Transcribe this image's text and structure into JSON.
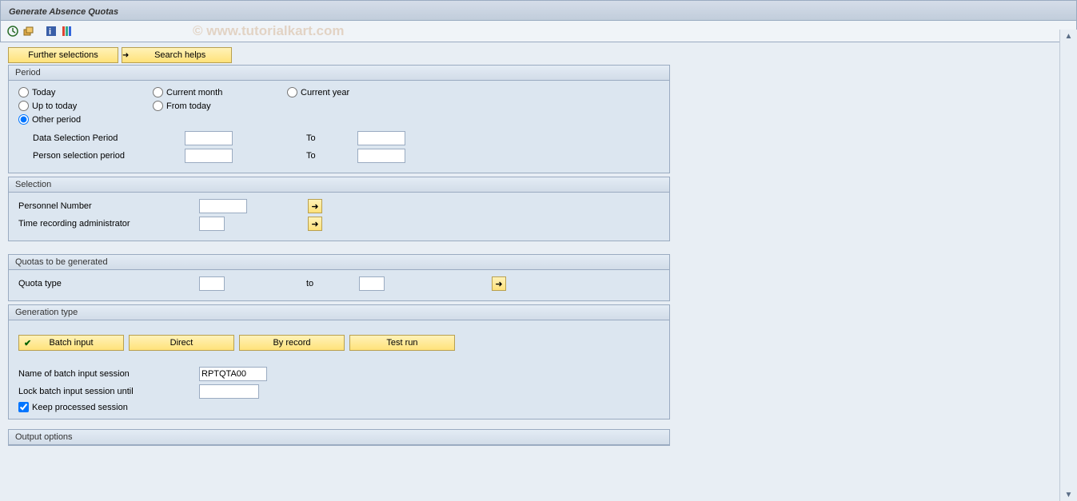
{
  "title": "Generate Absence Quotas",
  "watermark": "© www.tutorialkart.com",
  "topButtons": {
    "furtherSelections": "Further selections",
    "searchHelps": "Search helps"
  },
  "period": {
    "title": "Period",
    "today": "Today",
    "currentMonth": "Current month",
    "currentYear": "Current year",
    "upToToday": "Up to today",
    "fromToday": "From today",
    "otherPeriod": "Other period",
    "dataSelectionPeriod": "Data Selection Period",
    "personSelectionPeriod": "Person selection period",
    "to": "To"
  },
  "selection": {
    "title": "Selection",
    "personnelNumber": "Personnel Number",
    "timeRecordingAdmin": "Time recording administrator"
  },
  "quotas": {
    "title": "Quotas to be generated",
    "quotaType": "Quota type",
    "to": "to"
  },
  "generation": {
    "title": "Generation type",
    "batchInput": "Batch input",
    "direct": "Direct",
    "byRecord": "By record",
    "testRun": "Test run",
    "nameOfBatchSession": "Name of batch input session",
    "nameValue": "RPTQTA00",
    "lockBatchSession": "Lock batch input session until",
    "keepProcessed": "Keep processed session"
  },
  "output": {
    "title": "Output options"
  }
}
